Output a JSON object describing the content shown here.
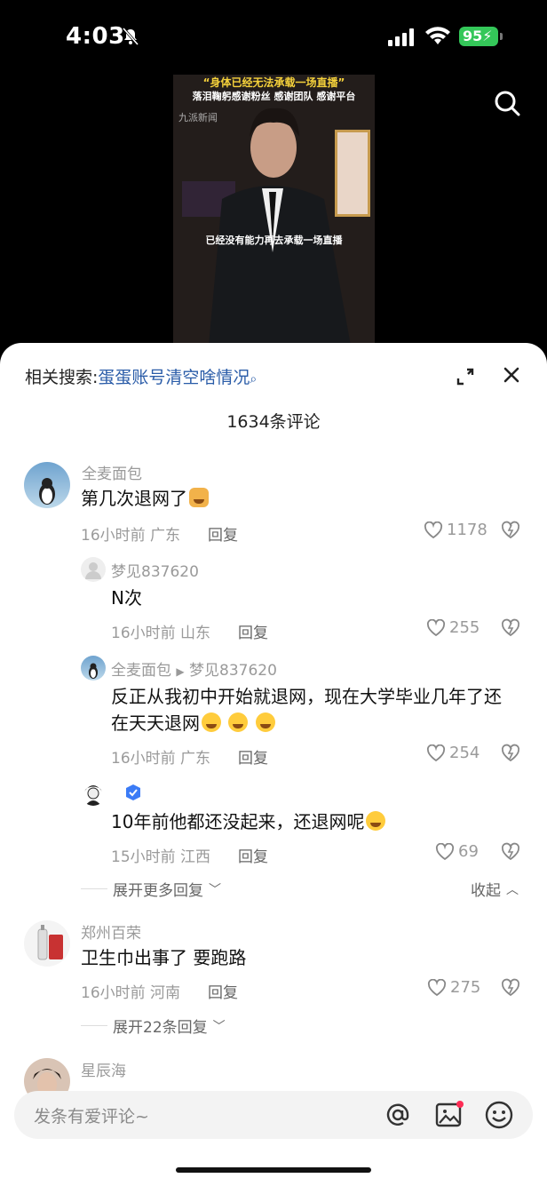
{
  "status": {
    "time": "4:03",
    "battery": "95"
  },
  "video": {
    "caption_top": "“身体已经无法承载一场直播”",
    "caption_second": "落泪鞠躬感谢粉丝 感谢团队 感谢平台",
    "watermark": "九派新闻",
    "subtitle": "已经没有能力再去承载一场直播"
  },
  "sheet": {
    "related_label": "相关搜索:",
    "related_query": "蛋蛋账号清空啥情况",
    "comment_count": "1634条评论"
  },
  "comments": [
    {
      "user": "全麦面包",
      "text": "第几次退网了",
      "time": "16小时前",
      "region": "广东",
      "reply": "回复",
      "likes": "1178"
    },
    {
      "user": "梦见837620",
      "text": "N次",
      "time": "16小时前",
      "region": "山东",
      "reply": "回复",
      "likes": "255"
    },
    {
      "user": "全麦面包",
      "reply_to": "梦见837620",
      "text_line1": "反正从我初中开始就退网，现在大学毕业几年了还",
      "text_line2": "在天天退网",
      "time": "16小时前",
      "region": "广东",
      "reply": "回复",
      "likes": "254"
    },
    {
      "user": "",
      "text": "10年前他都还没起来，还退网呢",
      "time": "15小时前",
      "region": "江西",
      "reply": "回复",
      "likes": "69"
    },
    {
      "user": "郑州百荣",
      "text": "卫生巾出事了  要跑路",
      "time": "16小时前",
      "region": "河南",
      "reply": "回复",
      "likes": "275"
    },
    {
      "user": "星辰海"
    }
  ],
  "thread": {
    "expand_more": "展开更多回复",
    "collapse": "收起",
    "expand_22": "展开22条回复"
  },
  "input": {
    "placeholder": "发条有爱评论~"
  }
}
